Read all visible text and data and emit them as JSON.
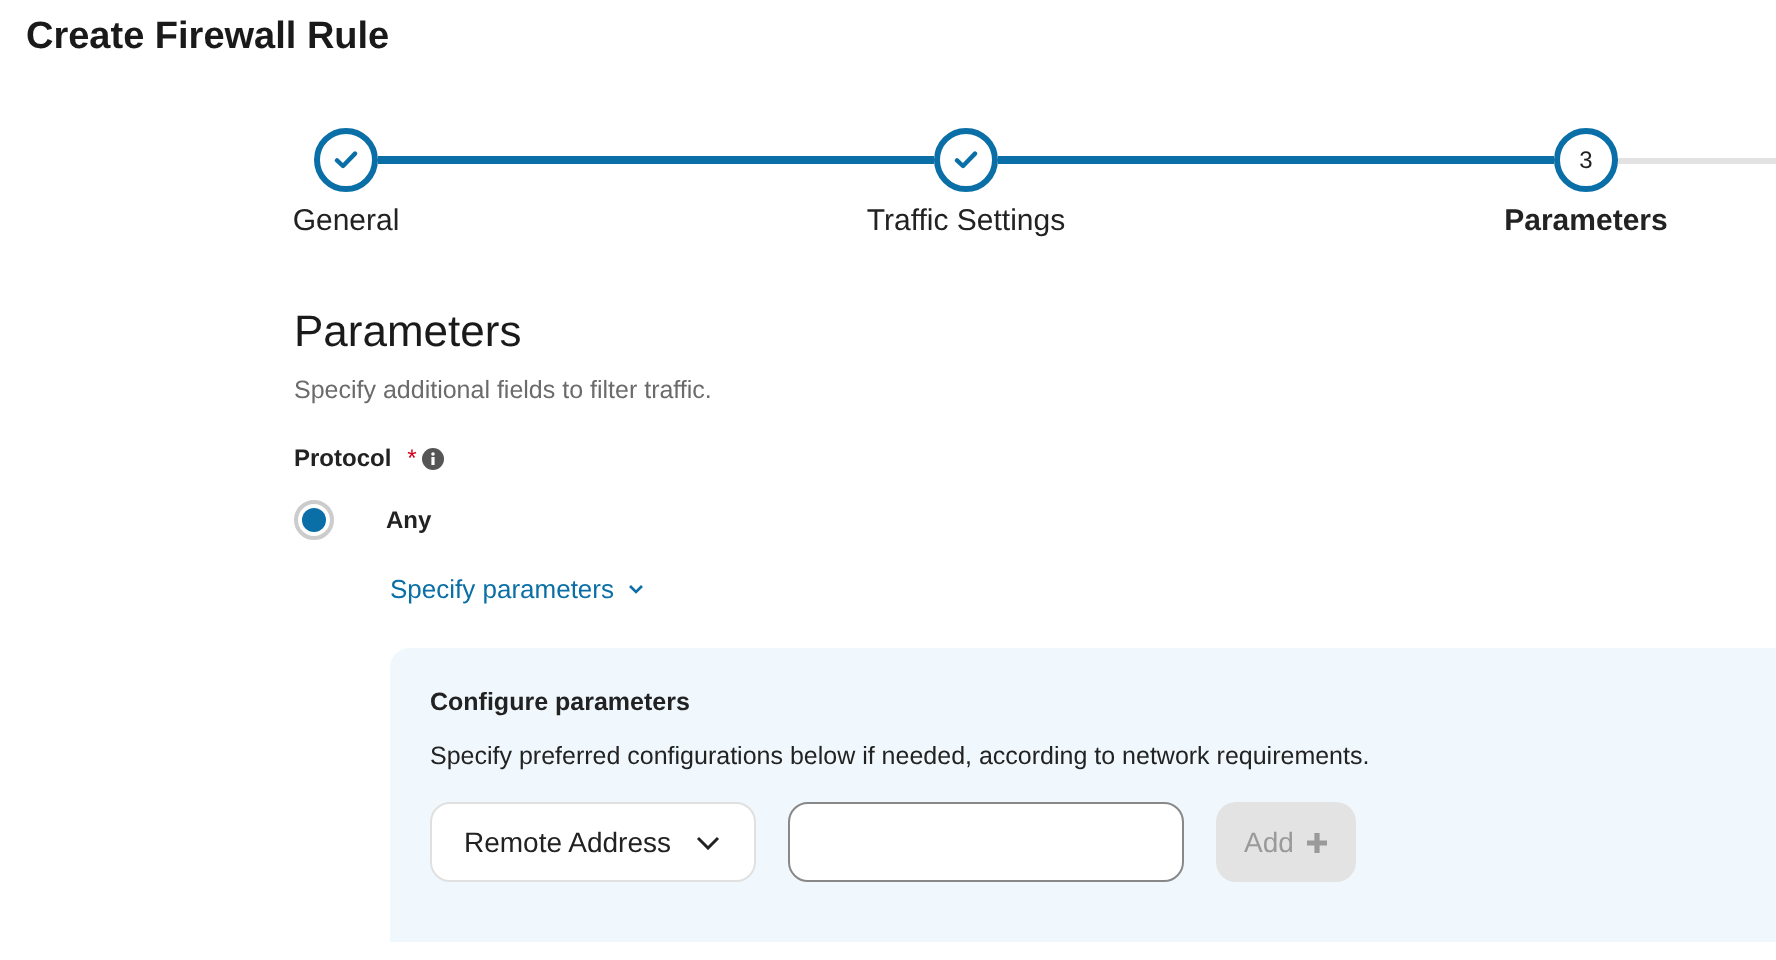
{
  "page_title": "Create Firewall Rule",
  "steps": [
    {
      "label": "General",
      "completed": true,
      "selected": false
    },
    {
      "label": "Traffic Settings",
      "completed": true,
      "selected": false
    },
    {
      "label": "Parameters",
      "completed": false,
      "selected": true,
      "number": "3"
    }
  ],
  "section": {
    "title": "Parameters",
    "description": "Specify additional fields to filter traffic."
  },
  "protocol": {
    "label": "Protocol",
    "required_mark": "*",
    "options": [
      {
        "label": "Any",
        "selected": true
      }
    ]
  },
  "specify_link": {
    "label": "Specify parameters",
    "expanded": true
  },
  "configure": {
    "title": "Configure parameters",
    "description": "Specify preferred configurations below if needed, according to network requirements.",
    "dropdown": "Remote Address",
    "add_button": {
      "label": "Add",
      "disabled": true
    }
  }
}
